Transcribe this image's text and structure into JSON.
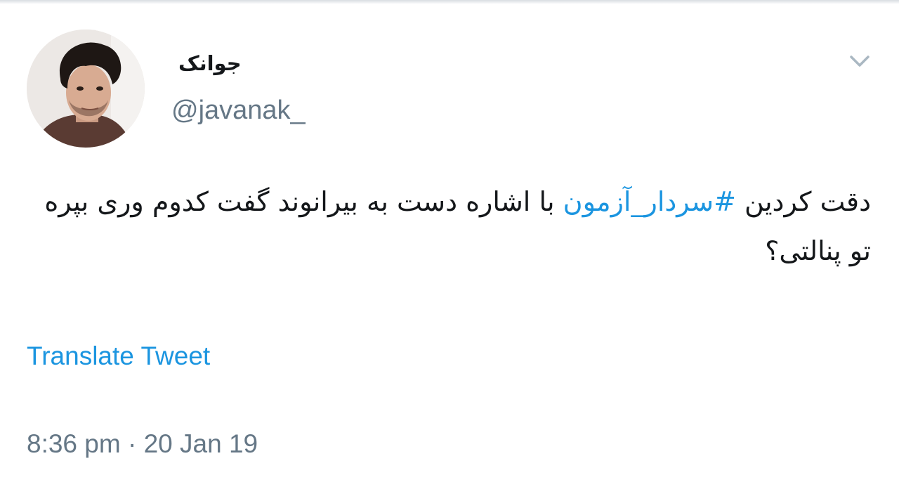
{
  "tweet": {
    "author": {
      "display_name": "جوانک",
      "handle": "@javanak_",
      "avatar_icon": "profile-photo"
    },
    "menu_icon": "chevron-down-icon",
    "text_before_hashtag": "دقت کردین ",
    "hashtag": "#سردار_آزمون",
    "text_after_hashtag": " با اشاره دست به بیرانوند گفت کدوم وری بپره تو پنالتی؟",
    "translate_label": "Translate Tweet",
    "timestamp": "8:36 pm · 20 Jan 19"
  },
  "colors": {
    "link": "#1b95e0",
    "text": "#14171a",
    "muted": "#657786",
    "chevron": "#aab8c2"
  }
}
